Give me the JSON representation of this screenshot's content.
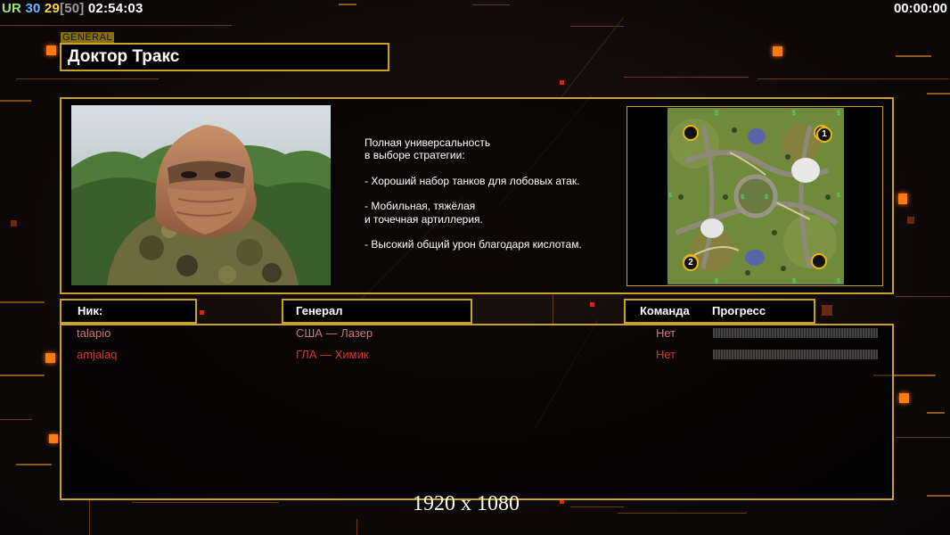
{
  "hud": {
    "ur_label": "UR",
    "fps": "30",
    "fps2": "29",
    "fps_cap": "[50]",
    "clock": "02:54:03",
    "game_timer": "00:00:00"
  },
  "general": {
    "tag": "GENERAL",
    "name": "Доктор Тракс",
    "description": [
      "Полная универсальность",
      "в выборе стратегии:",
      "",
      "- Хороший набор танков для лобовых атак.",
      "",
      "- Мобильная, тяжёлая",
      "и точечная артиллерия.",
      "",
      "- Высокий общий урон благодаря кислотам."
    ]
  },
  "map": {
    "start_positions": [
      "1",
      "2"
    ]
  },
  "table": {
    "headers": {
      "nick": "Ник:",
      "general": "Генерал",
      "team": "Команда",
      "progress": "Прогресс"
    },
    "players": [
      {
        "nick": "talapio",
        "general": "США — Лазер",
        "team": "Нет",
        "progress": 0,
        "color": "#c8787e"
      },
      {
        "nick": "amjalaq",
        "general": "ГЛА — Химик",
        "team": "Нет",
        "progress": 0,
        "color": "#e0302a"
      }
    ]
  },
  "resolution": "1920 x 1080",
  "colors": {
    "frame": "#c9a326",
    "accent": "#ff7a12"
  }
}
